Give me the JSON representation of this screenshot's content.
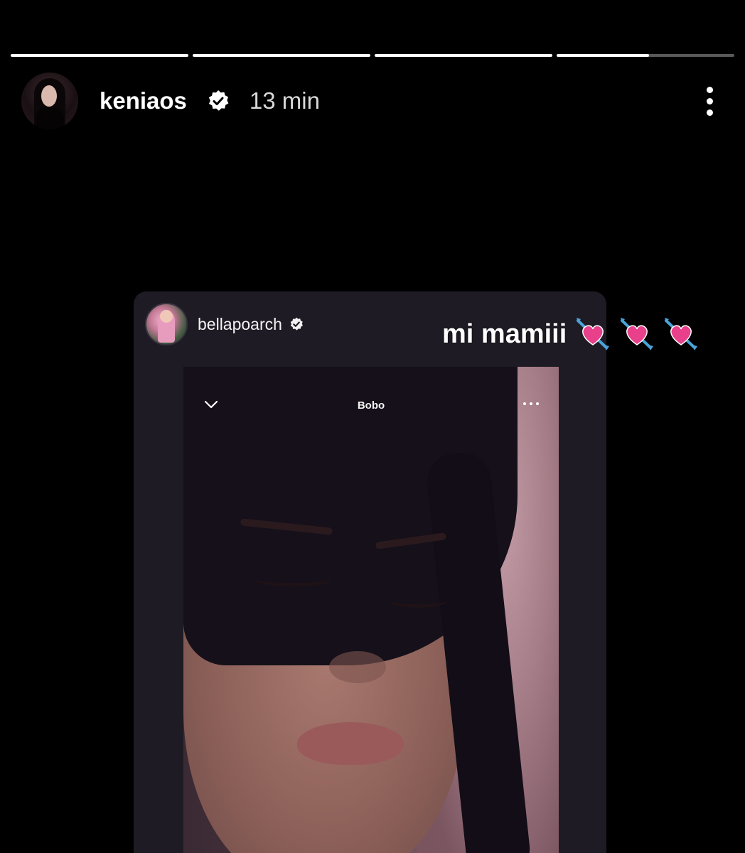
{
  "story": {
    "progress": [
      1,
      1,
      1,
      0.52
    ],
    "author": {
      "username": "keniaos",
      "verified": true,
      "time_ago": "13 min"
    }
  },
  "shared_post": {
    "username": "bellapoarch",
    "verified": true,
    "video_title": "Bobo"
  },
  "caption": {
    "text": "mi mamiii",
    "emoji_count": 3
  },
  "colors": {
    "background": "#000000",
    "card": "#1e1b24",
    "heart": "#e8408a",
    "arrow": "#4aa3d8"
  }
}
